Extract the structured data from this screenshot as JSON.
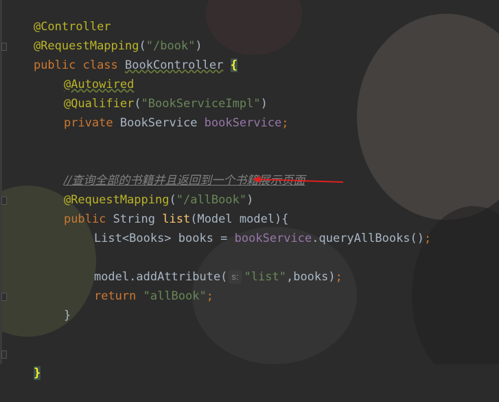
{
  "colors": {
    "background": "#2b2b2b",
    "annotation": "#bbb529",
    "string": "#6a8759",
    "keyword": "#cc7832",
    "field": "#9876aa",
    "method": "#ffc66d",
    "text": "#a9b7c6",
    "comment": "#808080",
    "arrow": "#e02020"
  },
  "code": {
    "l1": {
      "ann": "@Controller"
    },
    "l2": {
      "ann": "@RequestMapping",
      "p1": "(",
      "str": "\"/book\"",
      "p2": ")"
    },
    "l3": {
      "kw": "public class ",
      "cls": "BookController",
      "sp": " ",
      "brace": "{"
    },
    "l4": {
      "ann": "@Autowired"
    },
    "l5": {
      "ann": "@Qualifier",
      "p1": "(",
      "str": "\"BookServiceImpl\"",
      "p2": ")"
    },
    "l6": {
      "kw": "private ",
      "type": "BookService ",
      "fld": "bookService",
      "semi": ";"
    },
    "l9": {
      "comment": "//查询全部的书籍并且返回到一个书籍展示页面"
    },
    "l10": {
      "ann": "@RequestMapping",
      "p1": "(",
      "str": "\"/allBook\"",
      "p2": ")"
    },
    "l11": {
      "kw": "public ",
      "type": "String ",
      "mth": "list",
      "rest": "(Model model){"
    },
    "l12": {
      "pre": "List<Books> books = ",
      "fld": "bookService",
      "call": ".queryAllBooks()",
      "semi": ";"
    },
    "l14": {
      "pre": "model.addAttribute(",
      "hint": "s:",
      "str": "\"list\"",
      "rest": ",books)",
      "semi": ";"
    },
    "l15": {
      "kw": "return ",
      "str": "\"allBook\"",
      "semi": ";"
    },
    "l16": {
      "brace": "}"
    },
    "l19": {
      "brace": "}"
    }
  }
}
